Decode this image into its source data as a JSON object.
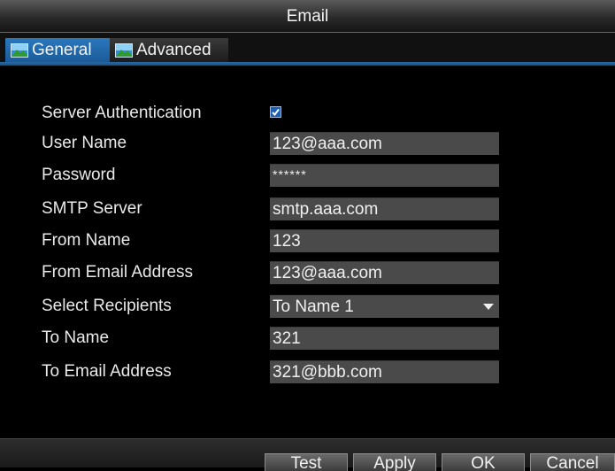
{
  "window": {
    "title": "Email"
  },
  "tabs": [
    {
      "label": "General",
      "icon": "landscape-icon",
      "active": true
    },
    {
      "label": "Advanced",
      "icon": "landscape-icon",
      "active": false
    }
  ],
  "form": {
    "server_auth": {
      "label": "Server Authentication",
      "checked": true
    },
    "user_name": {
      "label": "User Name",
      "value": "123@aaa.com"
    },
    "password": {
      "label": "Password",
      "value": "******"
    },
    "smtp_server": {
      "label": "SMTP Server",
      "value": "smtp.aaa.com"
    },
    "from_name": {
      "label": "From Name",
      "value": "123"
    },
    "from_email": {
      "label": "From Email Address",
      "value": "123@aaa.com"
    },
    "select_recipients": {
      "label": "Select Recipients",
      "value": "To Name 1"
    },
    "to_name": {
      "label": "To Name",
      "value": "321"
    },
    "to_email": {
      "label": "To Email Address",
      "value": "321@bbb.com"
    }
  },
  "buttons": {
    "test": "Test",
    "apply": "Apply",
    "ok": "OK",
    "cancel": "Cancel"
  },
  "colors": {
    "tab_active": "#1f66a8",
    "accent_line": "#1f5b95",
    "field_bg": "#4a4a4a"
  }
}
